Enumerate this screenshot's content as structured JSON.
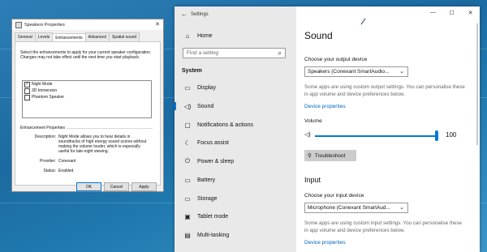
{
  "dialog": {
    "title": "Speakers Properties",
    "close": "✕",
    "tabs": [
      "General",
      "Levels",
      "Enhancements",
      "Advanced",
      "Spatial sound"
    ],
    "active_tab": "Enhancements",
    "instructions": "Select the enhancements to apply for your current speaker configuration. Changes may not take effect until the next time you start playback.",
    "enhancements": [
      {
        "label": "Night Mode",
        "checked": true
      },
      {
        "label": "3D Immersion",
        "checked": false
      },
      {
        "label": "Phantom Speaker",
        "checked": false
      }
    ],
    "group_title": "Enhancement Properties",
    "description_key": "Description:",
    "description": "Night Mode allows you to hear details in soundtracks of high energy sound scores without making the volume louder, which is especially useful for late-night viewing.",
    "provider_key": "Provider:",
    "provider": "Conexant",
    "status_key": "Status:",
    "status": "Enabled",
    "buttons": {
      "ok": "OK",
      "cancel": "Cancel",
      "apply": "Apply"
    }
  },
  "settings": {
    "title": "Settings",
    "home": "Home",
    "search_placeholder": "Find a setting",
    "category": "System",
    "nav": [
      {
        "label": "Display",
        "icon": "▭"
      },
      {
        "label": "Sound",
        "icon": "◁)"
      },
      {
        "label": "Notifications & actions",
        "icon": "▢"
      },
      {
        "label": "Focus assist",
        "icon": "☾"
      },
      {
        "label": "Power & sleep",
        "icon": "⏻"
      },
      {
        "label": "Battery",
        "icon": "▭"
      },
      {
        "label": "Storage",
        "icon": "▭"
      },
      {
        "label": "Tablet mode",
        "icon": "▣"
      },
      {
        "label": "Multi-tasking",
        "icon": "▤"
      }
    ],
    "selected_nav": "Sound",
    "window_controls": {
      "minimize": "—",
      "maximize": "☐",
      "close": "✕"
    },
    "page_title": "Sound",
    "output_label": "Choose your output device",
    "output_device": "Speakers (Conexant SmartAudio...",
    "output_note": "Some apps are using custom output settings. You can personalise these in app volume and device preferences below.",
    "device_properties": "Device properties",
    "volume_label": "Volume",
    "volume_value": "100",
    "troubleshoot": "Troubleshoot",
    "input_title": "Input",
    "input_label": "Choose your input device",
    "input_device": "Microphone (Conexant SmartAud...",
    "input_note": "Some apps are using custom input settings. You can personalise these in app volume and device preferences below.",
    "input_device_properties": "Device properties"
  },
  "colors": {
    "accent": "#0078d7",
    "link": "#0067c0",
    "nav_bg": "#e9e9e9"
  }
}
